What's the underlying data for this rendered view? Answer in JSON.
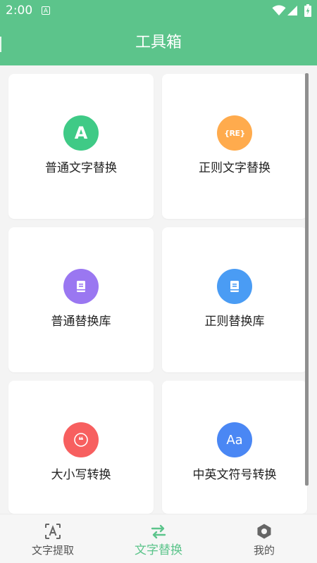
{
  "status_bar": {
    "time": "2:00",
    "notification_icon_text": "A",
    "icons": [
      "wifi-icon",
      "signal-icon",
      "battery-charging-icon"
    ]
  },
  "header": {
    "title": "工具箱",
    "background_color": "#5cc48b"
  },
  "tools": [
    {
      "label": "普通文字替换",
      "icon": "letter-a-icon",
      "icon_text": "A",
      "color": "#3fca86"
    },
    {
      "label": "正则文字替换",
      "icon": "regex-icon",
      "icon_text": "{RE}",
      "color": "#ffab4d"
    },
    {
      "label": "普通替换库",
      "icon": "book-icon",
      "color": "#9a77f1"
    },
    {
      "label": "正则替换库",
      "icon": "book-icon",
      "color": "#4a9cf4"
    },
    {
      "label": "大小写转换",
      "icon": "quote-icon",
      "icon_text": "❝",
      "color": "#f75f5f"
    },
    {
      "label": "中英文符号转换",
      "icon": "font-aa-icon",
      "icon_text": "Aa",
      "color": "#4a87f4"
    }
  ],
  "bottom_nav": {
    "active_index": 1,
    "active_color": "#5cc48b",
    "items": [
      {
        "label": "文字提取",
        "icon": "text-scan-icon"
      },
      {
        "label": "文字替换",
        "icon": "swap-arrows-icon"
      },
      {
        "label": "我的",
        "icon": "hexagon-settings-icon"
      }
    ]
  }
}
